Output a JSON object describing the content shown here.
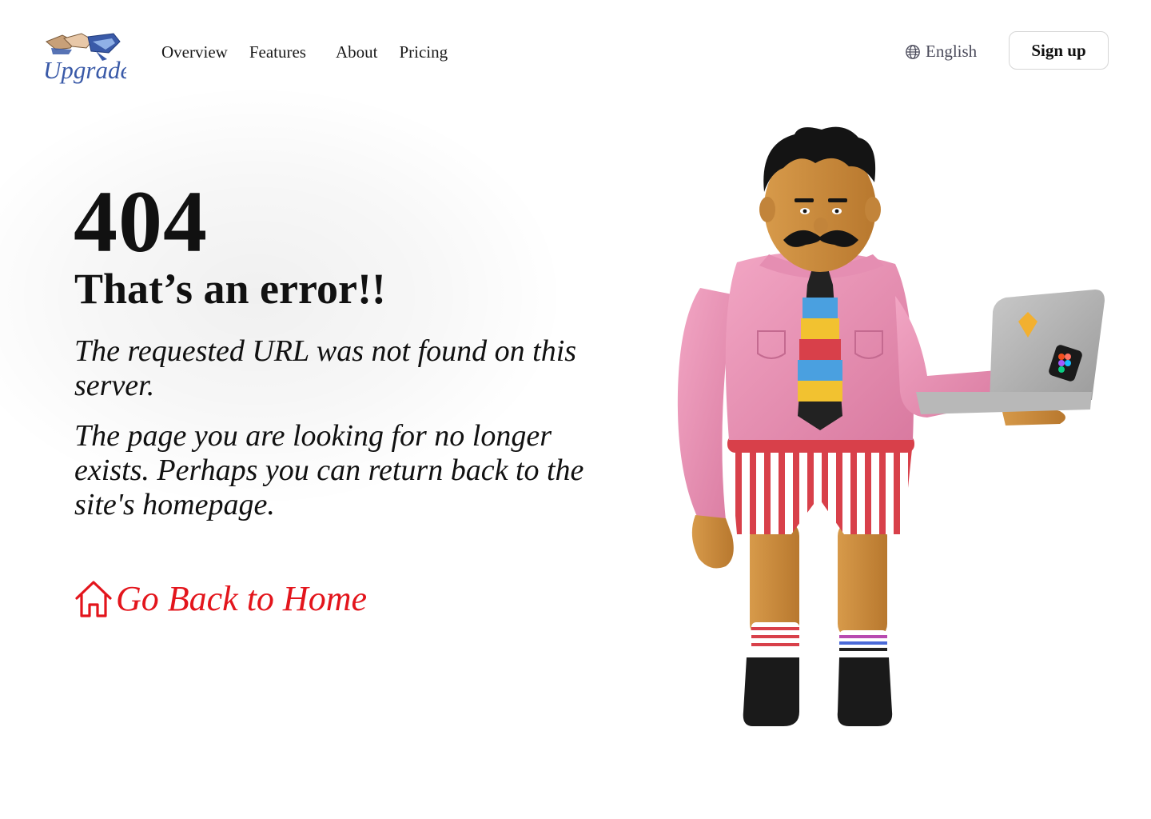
{
  "header": {
    "logo_text": "Upgrade",
    "nav": {
      "overview": "Overview",
      "features": "Features",
      "about": "About",
      "pricing": "Pricing"
    },
    "language": "English",
    "signup_label": "Sign up"
  },
  "error": {
    "code": "404",
    "headline": "That’s an error!!",
    "message_1": "The requested URL was not found on this server.",
    "message_2": "The page you are looking for no longer exists. Perhaps you can return back to the site's homepage.",
    "home_link_label": "Go Back to Home"
  },
  "icons": {
    "language": "globe-icon",
    "home_link": "house-icon"
  },
  "colors": {
    "accent_red": "#e3151c",
    "text": "#111111",
    "language_text": "#4a4a5a",
    "logo_blue": "#3a5aa8"
  }
}
